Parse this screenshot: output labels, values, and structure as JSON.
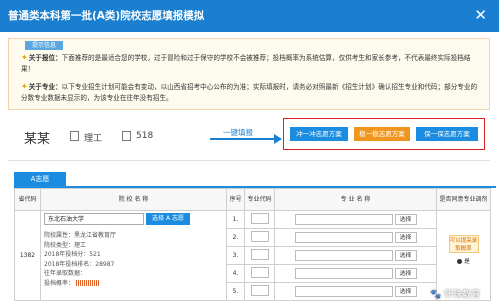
{
  "window": {
    "title": "普通类本科第一批(A类)院校志愿填报模拟",
    "close": "✕"
  },
  "notice": {
    "tag": "提示信息",
    "note1_label": "关于报位：",
    "note1_text": "下面推荐的是最适合您的学校，过于冒险和过于保守的学校不会被推荐；投档概率为系统估算，仅供考生和家长参考，不代表最终实际投档结果！",
    "note2_label": "关于专业：",
    "note2_text": "以下专业招生计划可能会有变动，以山西省招考中心公布的为准；实际填报时，请务必对照最新《招生计划》确认招生专业和代码；部分专业的分数专业数据未显示的，为该专业在往年没有招生。"
  },
  "student": {
    "name": "某某",
    "track": "理工",
    "score": "518"
  },
  "action": {
    "label": "一键填报",
    "plan_a": "冲一冲志愿方案",
    "plan_b": "稳一稳志愿方案",
    "plan_c": "保一保志愿方案"
  },
  "volunteer_tab": "A志愿",
  "table": {
    "headers": {
      "code": "省代码",
      "school": "院 校 名 称",
      "seq": "序号",
      "major_code": "专业代码",
      "major_name": "专 业 名 称",
      "adjust": "是否同意专业调剂"
    },
    "row": {
      "province_code": "1382",
      "school_name": "东北石油大学",
      "pick_label": "选择 A 志愿",
      "attr": "院校属性：黑龙江省教育厅",
      "type": "院校类型：理工",
      "plan": "2018年投档分：521",
      "rank": "2018年投档排名：28987",
      "hist": "往年录取数据：",
      "prob_label": "投档概率：",
      "majors": [
        {
          "seq": "1.",
          "choose": "选择"
        },
        {
          "seq": "2.",
          "choose": "选择"
        },
        {
          "seq": "3.",
          "choose": "选择"
        },
        {
          "seq": "4.",
          "choose": "选择"
        },
        {
          "seq": "5.",
          "choose": "选择"
        }
      ],
      "adjust_tag": "可以提高录取概率",
      "adjust_yes": "是",
      "adjust_no": "否"
    }
  },
  "watermark": "🐾 怀珠教育"
}
